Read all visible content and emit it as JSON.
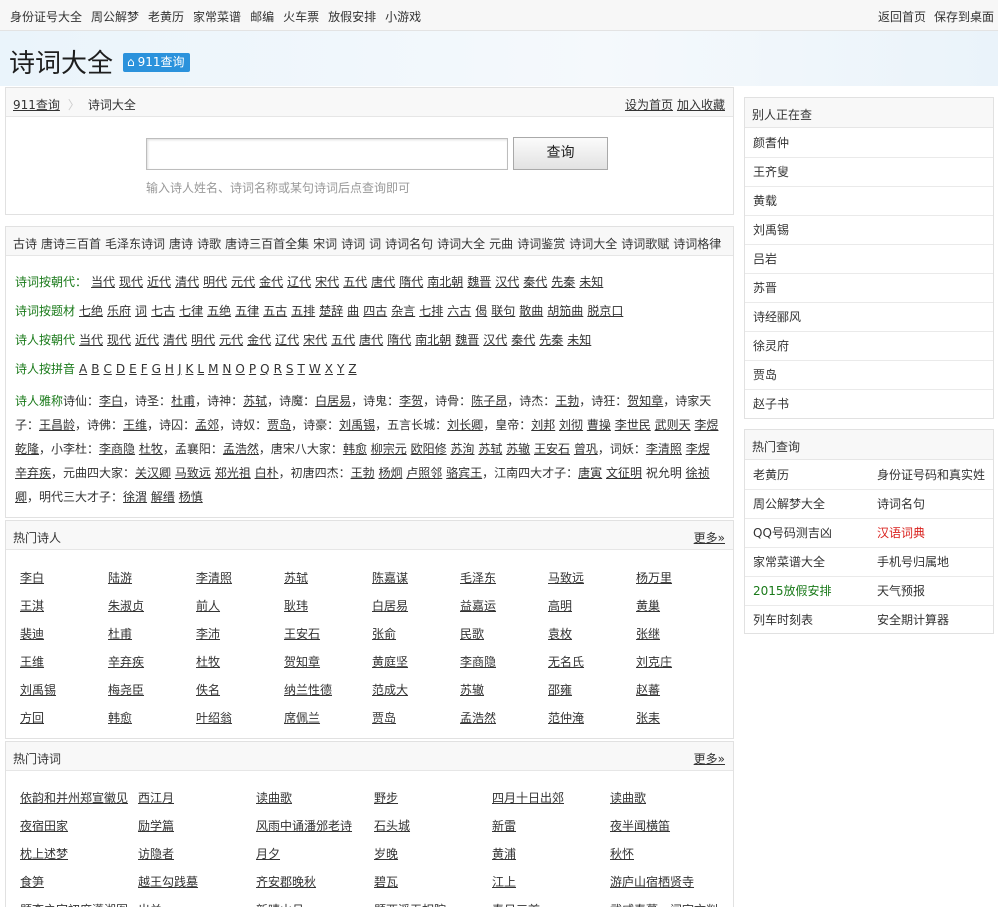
{
  "topbar": {
    "left_links": [
      "身份证号大全",
      "周公解梦",
      "老黄历",
      "家常菜谱",
      "邮编",
      "火车票",
      "放假安排",
      "小游戏"
    ],
    "right_links": [
      "返回首页",
      "保存到桌面"
    ]
  },
  "header": {
    "title": "诗词大全",
    "badge": "911查询"
  },
  "breadcrumb": {
    "home": "911查询",
    "current": "诗词大全",
    "set_home": "设为首页",
    "add_fav": "加入收藏"
  },
  "search": {
    "value": "",
    "placeholder": "",
    "button": "查询",
    "hint": "输入诗人姓名、诗词名称或某句诗词后点查询即可"
  },
  "tags": [
    "古诗",
    "唐诗三百首",
    "毛泽东诗词",
    "唐诗",
    "诗歌",
    "唐诗三百首全集",
    "宋词",
    "诗词",
    "词",
    "诗词名句",
    "诗词大全",
    "元曲",
    "诗词鉴赏",
    "诗词大全",
    "诗词歌赋",
    "诗词格律"
  ],
  "categories": [
    {
      "label": "诗词按朝代：",
      "items": [
        "当代",
        "现代",
        "近代",
        "清代",
        "明代",
        "元代",
        "金代",
        "辽代",
        "宋代",
        "五代",
        "唐代",
        "隋代",
        "南北朝",
        "魏晋",
        "汉代",
        "秦代",
        "先秦",
        "未知"
      ]
    },
    {
      "label": "诗词按题材",
      "items": [
        "七绝",
        "乐府",
        "词",
        "七古",
        "七律",
        "五绝",
        "五律",
        "五古",
        "五排",
        "楚辞",
        "曲",
        "四古",
        "杂言",
        "七排",
        "六古",
        "偈",
        "联句",
        "散曲",
        "胡笳曲",
        "脱京口"
      ]
    },
    {
      "label": "诗人按朝代",
      "items": [
        "当代",
        "现代",
        "近代",
        "清代",
        "明代",
        "元代",
        "金代",
        "辽代",
        "宋代",
        "五代",
        "唐代",
        "隋代",
        "南北朝",
        "魏晋",
        "汉代",
        "秦代",
        "先秦",
        "未知"
      ]
    },
    {
      "label": "诗人按拼音",
      "items": [
        "A",
        "B",
        "C",
        "D",
        "E",
        "F",
        "G",
        "H",
        "J",
        "K",
        "L",
        "M",
        "N",
        "O",
        "P",
        "Q",
        "R",
        "S",
        "T",
        "W",
        "X",
        "Y",
        "Z"
      ]
    }
  ],
  "yahao": {
    "label": "诗人雅称",
    "segments": [
      {
        "t": "诗仙：",
        "u": false
      },
      {
        "t": "李白",
        "u": true
      },
      {
        "t": "，诗圣：",
        "u": false
      },
      {
        "t": "杜甫",
        "u": true
      },
      {
        "t": "，诗神：",
        "u": false
      },
      {
        "t": "苏轼",
        "u": true
      },
      {
        "t": "，诗魔：",
        "u": false
      },
      {
        "t": "白居易",
        "u": true
      },
      {
        "t": "，诗鬼：",
        "u": false
      },
      {
        "t": "李贺",
        "u": true
      },
      {
        "t": "，诗骨：",
        "u": false
      },
      {
        "t": "陈子昂",
        "u": true
      },
      {
        "t": "，诗杰：",
        "u": false
      },
      {
        "t": "王勃",
        "u": true
      },
      {
        "t": "，诗狂：",
        "u": false
      },
      {
        "t": "贺知章",
        "u": true
      },
      {
        "t": "，诗家天子：",
        "u": false
      },
      {
        "t": "王昌龄",
        "u": true
      },
      {
        "t": "，诗佛：",
        "u": false
      },
      {
        "t": "王维",
        "u": true
      },
      {
        "t": "，诗囚：",
        "u": false
      },
      {
        "t": "孟郊",
        "u": true
      },
      {
        "t": "，诗奴：",
        "u": false
      },
      {
        "t": "贾岛",
        "u": true
      },
      {
        "t": "，诗豪：",
        "u": false
      },
      {
        "t": "刘禹锡",
        "u": true
      },
      {
        "t": "，五言长城：",
        "u": false
      },
      {
        "t": "刘长卿",
        "u": true
      },
      {
        "t": "，皇帝：",
        "u": false
      },
      {
        "t": "刘邦",
        "u": true
      },
      {
        "t": " ",
        "u": false
      },
      {
        "t": "刘彻",
        "u": true
      },
      {
        "t": " ",
        "u": false
      },
      {
        "t": "曹操",
        "u": true
      },
      {
        "t": " ",
        "u": false
      },
      {
        "t": "李世民",
        "u": true
      },
      {
        "t": " ",
        "u": false
      },
      {
        "t": "武则天",
        "u": true
      },
      {
        "t": " ",
        "u": false
      },
      {
        "t": "李煜",
        "u": true
      },
      {
        "t": " ",
        "u": false
      },
      {
        "t": "乾隆",
        "u": true
      },
      {
        "t": "，小李杜：",
        "u": false
      },
      {
        "t": "李商隐",
        "u": true
      },
      {
        "t": " ",
        "u": false
      },
      {
        "t": "杜牧",
        "u": true
      },
      {
        "t": "，孟襄阳：",
        "u": false
      },
      {
        "t": "孟浩然",
        "u": true
      },
      {
        "t": "，唐宋八大家：",
        "u": false
      },
      {
        "t": "韩愈",
        "u": true
      },
      {
        "t": " ",
        "u": false
      },
      {
        "t": "柳宗元",
        "u": true
      },
      {
        "t": " ",
        "u": false
      },
      {
        "t": "欧阳修",
        "u": true
      },
      {
        "t": " ",
        "u": false
      },
      {
        "t": "苏洵",
        "u": true
      },
      {
        "t": " ",
        "u": false
      },
      {
        "t": "苏轼",
        "u": true
      },
      {
        "t": " ",
        "u": false
      },
      {
        "t": "苏辙",
        "u": true
      },
      {
        "t": " ",
        "u": false
      },
      {
        "t": "王安石",
        "u": true
      },
      {
        "t": " ",
        "u": false
      },
      {
        "t": "曾巩",
        "u": true
      },
      {
        "t": "，词妖：",
        "u": false
      },
      {
        "t": "李清照",
        "u": true
      },
      {
        "t": " ",
        "u": false
      },
      {
        "t": "李煜",
        "u": true
      },
      {
        "t": " ",
        "u": false
      },
      {
        "t": "辛弃疾",
        "u": true
      },
      {
        "t": "，元曲四大家：",
        "u": false
      },
      {
        "t": "关汉卿",
        "u": true
      },
      {
        "t": " ",
        "u": false
      },
      {
        "t": "马致远",
        "u": true
      },
      {
        "t": " ",
        "u": false
      },
      {
        "t": "郑光祖",
        "u": true
      },
      {
        "t": " ",
        "u": false
      },
      {
        "t": "白朴",
        "u": true
      },
      {
        "t": "，初唐四杰：",
        "u": false
      },
      {
        "t": "王勃",
        "u": true
      },
      {
        "t": " ",
        "u": false
      },
      {
        "t": "杨炯",
        "u": true
      },
      {
        "t": " ",
        "u": false
      },
      {
        "t": "卢照邻",
        "u": true
      },
      {
        "t": " ",
        "u": false
      },
      {
        "t": "骆宾王",
        "u": true
      },
      {
        "t": "，江南四大才子：",
        "u": false
      },
      {
        "t": "唐寅",
        "u": true
      },
      {
        "t": " ",
        "u": false
      },
      {
        "t": "文征明",
        "u": true
      },
      {
        "t": " 祝允明 ",
        "u": false
      },
      {
        "t": "徐祯卿",
        "u": true
      },
      {
        "t": "，明代三大才子：",
        "u": false
      },
      {
        "t": "徐渭",
        "u": true
      },
      {
        "t": " ",
        "u": false
      },
      {
        "t": "解缙",
        "u": true
      },
      {
        "t": " ",
        "u": false
      },
      {
        "t": "杨慎",
        "u": true
      }
    ]
  },
  "hot_poets": {
    "title": "热门诗人",
    "more": "更多»",
    "items": [
      "李白",
      "陆游",
      "李清照",
      "苏轼",
      "陈嘉谋",
      "毛泽东",
      "马致远",
      "杨万里",
      "王淇",
      "朱淑贞",
      "前人",
      "耿玮",
      "白居易",
      "益嘉运",
      "高明",
      "黄巢",
      "裴迪",
      "杜甫",
      "李沛",
      "王安石",
      "张俞",
      "民歌",
      "袁枚",
      "张继",
      "王维",
      "辛弃疾",
      "杜牧",
      "贺知章",
      "黄庭坚",
      "李商隐",
      "无名氏",
      "刘克庄",
      "刘禹锡",
      "梅尧臣",
      "佚名",
      "纳兰性德",
      "范成大",
      "苏辙",
      "邵雍",
      "赵蕃",
      "方回",
      "韩愈",
      "叶绍翁",
      "席佩兰",
      "贾岛",
      "孟浩然",
      "范仲淹",
      "张耒"
    ]
  },
  "hot_poems": {
    "title": "热门诗词",
    "more": "更多»",
    "items": [
      "依韵和并州郑宣徽见",
      "西江月",
      "读曲歌",
      "野步",
      "四月十日出郊",
      "读曲歌",
      "夜宿田家",
      "励学篇",
      "风雨中诵潘邠老诗",
      "石头城",
      "新雷",
      "夜半闻横笛",
      "枕上述梦",
      "访隐者",
      "月夕",
      "岁晚",
      "黄浦",
      "秋怀",
      "食笋",
      "越王勾践墓",
      "齐安郡晚秋",
      "碧瓦",
      "江上",
      "游庐山宿栖贤寺",
      "题李之家初度潇湘图",
      "出关",
      "新晴山月",
      "题西溪无相院",
      "春日三首",
      "武威春暮，闻宇文判"
    ]
  },
  "sidebar": {
    "recent": {
      "title": "别人正在查",
      "items": [
        "颜耆仲",
        "王齐叟",
        "黄载",
        "刘禹锡",
        "吕岩",
        "苏晋",
        "诗经郦风",
        "徐灵府",
        "贾岛",
        "赵子书"
      ]
    },
    "hot": {
      "title": "热门查询",
      "rows": [
        [
          "老黄历",
          "身份证号码和真实姓"
        ],
        [
          "周公解梦大全",
          "诗词名句"
        ],
        [
          "QQ号码测吉凶",
          "汉语词典"
        ],
        [
          "家常菜谱大全",
          "手机号归属地"
        ],
        [
          "2015放假安排",
          "天气预报"
        ],
        [
          "列车时刻表",
          "安全期计算器"
        ]
      ],
      "accent_red": "#d9201c",
      "accent_green": "#1a7a1a"
    }
  }
}
